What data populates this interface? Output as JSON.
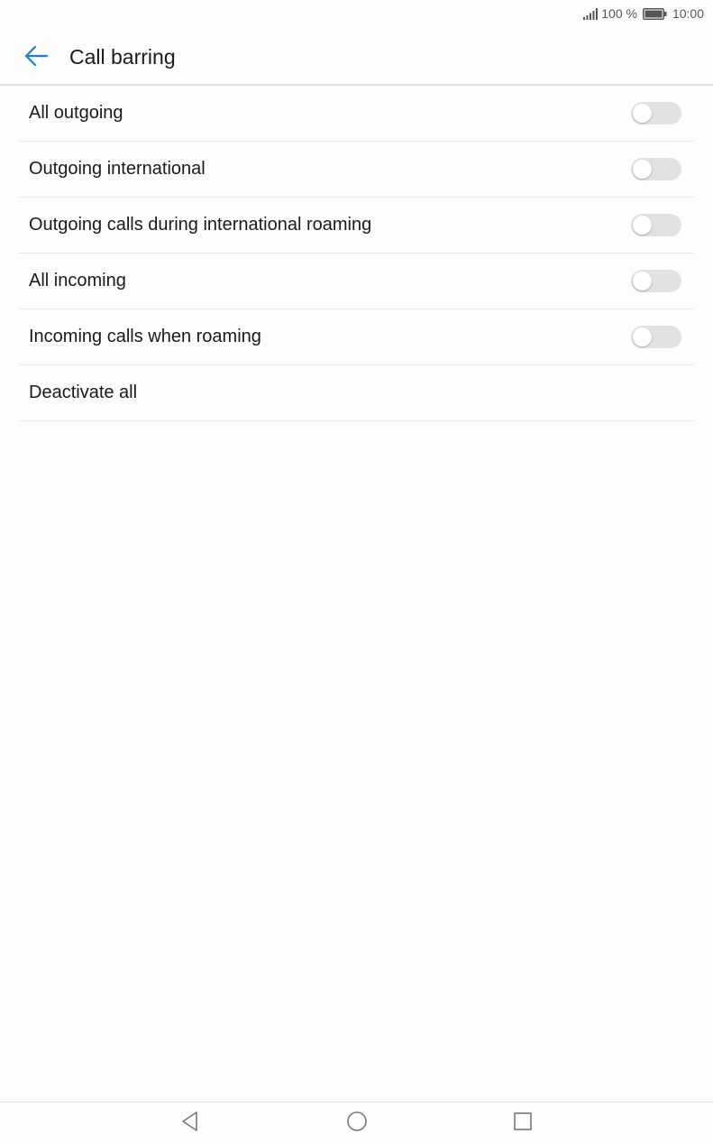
{
  "status_bar": {
    "battery_percent": "100 %",
    "time": "10:00",
    "icons": [
      "signal-icon",
      "battery-icon"
    ]
  },
  "app_bar": {
    "title": "Call barring",
    "back_icon": "arrow-left-icon"
  },
  "accent_color": "#1a7fdd",
  "settings": [
    {
      "label": "All outgoing",
      "toggle": "off"
    },
    {
      "label": "Outgoing international",
      "toggle": "off"
    },
    {
      "label": "Outgoing calls during international roaming",
      "toggle": "off"
    },
    {
      "label": "All incoming",
      "toggle": "off"
    },
    {
      "label": "Incoming calls when roaming",
      "toggle": "off"
    },
    {
      "label": "Deactivate all"
    }
  ],
  "nav_bar": {
    "icons": [
      "nav-back-icon",
      "nav-home-icon",
      "nav-recent-icon"
    ]
  }
}
